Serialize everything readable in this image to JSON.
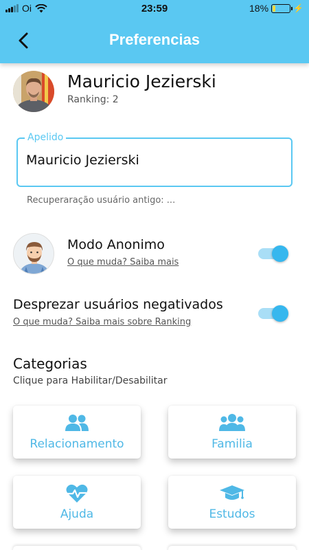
{
  "status_bar": {
    "carrier": "Oi",
    "time": "23:59",
    "battery_percent": "18%",
    "battery_level": 0.18,
    "icons": [
      "signal-icon",
      "wifi-icon",
      "battery-icon",
      "charging-icon"
    ]
  },
  "header": {
    "title": "Preferencias",
    "back_icon": "chevron-left-icon",
    "color": "#5ac8f2"
  },
  "profile": {
    "name": "Mauricio Jezierski",
    "ranking": "Ranking: 2"
  },
  "nickname_field": {
    "label": "Apelido",
    "value": "Mauricio Jezierski"
  },
  "recover_text": "Recuperaração usuário antigo: ...",
  "settings": [
    {
      "title": "Modo Anonimo",
      "link": "O que muda? Saiba mais",
      "enabled": true
    },
    {
      "title": "Desprezar usuários negativados",
      "link": "O que muda? Saiba mais sobre Ranking",
      "enabled": true
    }
  ],
  "categories": {
    "title": "Categorias",
    "subtitle": "Clique para Habilitar/Desabilitar",
    "items": [
      {
        "label": "Relacionamento",
        "icon": "users-icon"
      },
      {
        "label": "Familia",
        "icon": "family-icon"
      },
      {
        "label": "Ajuda",
        "icon": "heartbeat-icon"
      },
      {
        "label": "Estudos",
        "icon": "graduation-cap-icon"
      }
    ],
    "accent_color": "#4fb8e6"
  }
}
